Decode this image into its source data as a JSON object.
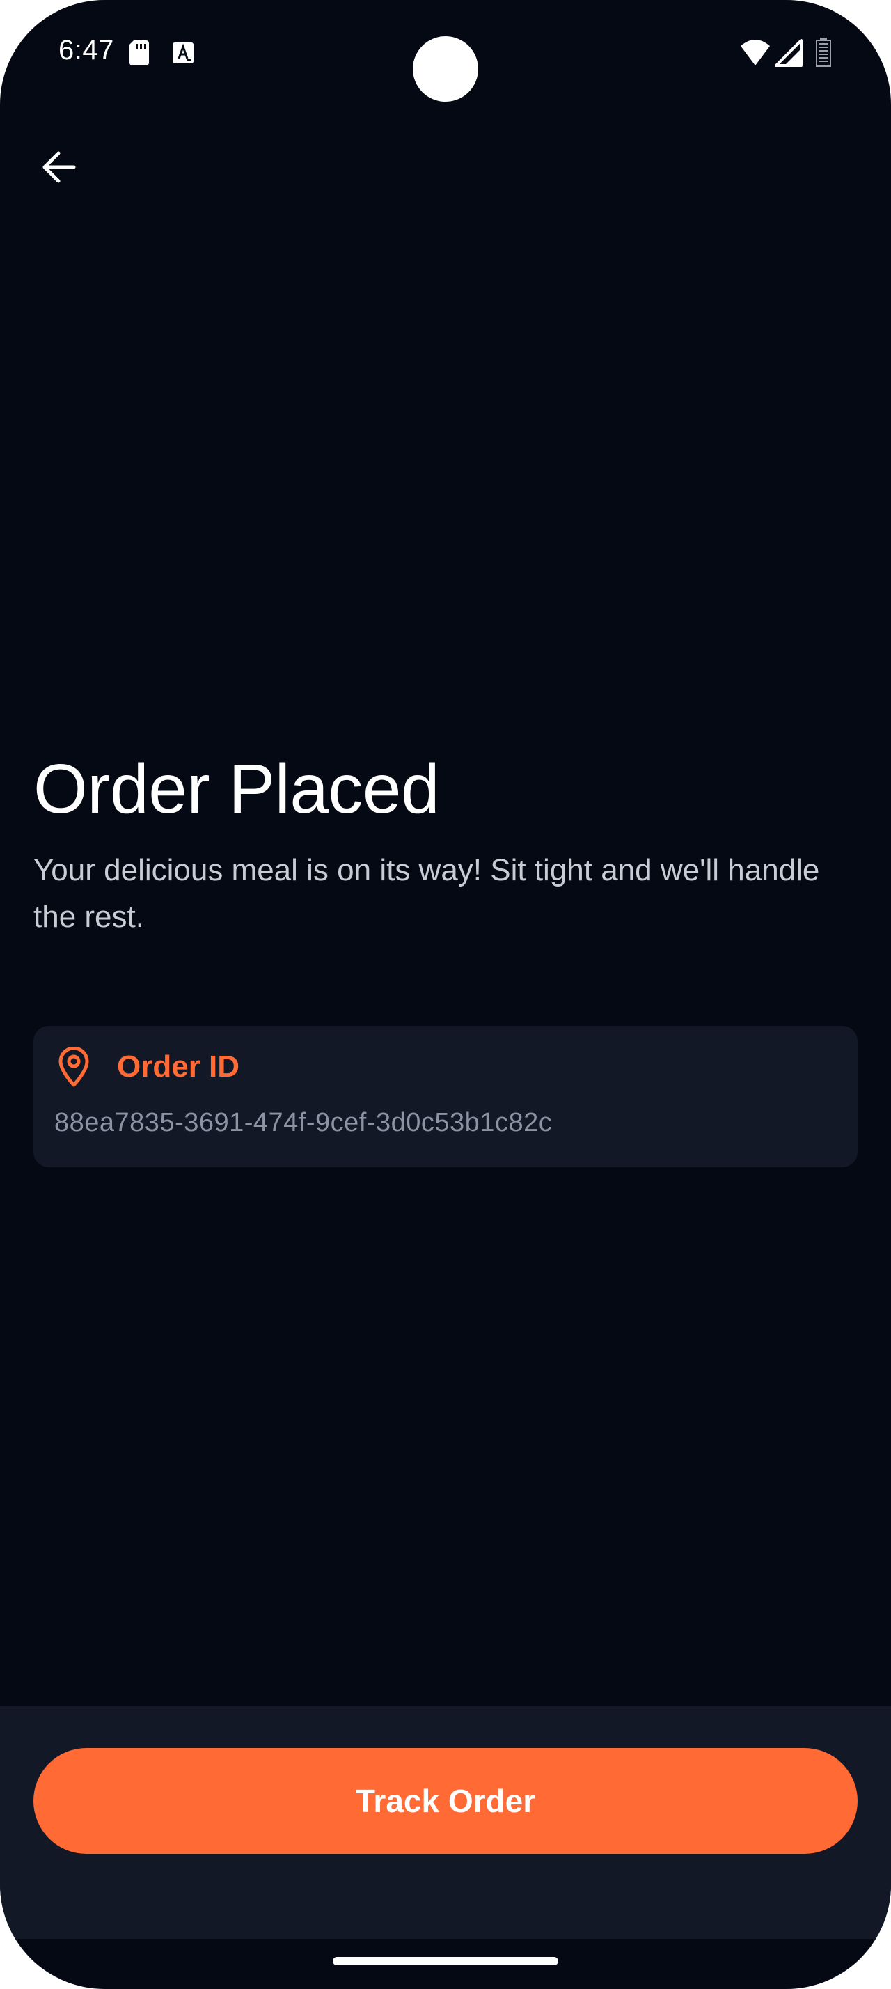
{
  "status_bar": {
    "time": "6:47",
    "sd_card_icon": "sd-card-icon",
    "notification_icon": "a-text-icon",
    "wifi_icon": "wifi-icon",
    "signal_icon": "cell-signal-icon",
    "battery_icon": "battery-icon"
  },
  "header": {
    "back_icon": "arrow-left-icon"
  },
  "main": {
    "title": "Order Placed",
    "subtitle": "Your delicious meal is on its way! Sit tight and we'll handle the rest.",
    "order_card": {
      "icon": "map-pin-icon",
      "label": "Order ID",
      "value": "88ea7835-3691-474f-9cef-3d0c53b1c82c"
    }
  },
  "footer": {
    "track_button_label": "Track Order"
  },
  "colors": {
    "background": "#050913",
    "card": "#121826",
    "accent": "#ff6a35",
    "text_primary": "#ffffff",
    "text_secondary": "#c9ccd4",
    "text_muted": "#8c93a3"
  }
}
